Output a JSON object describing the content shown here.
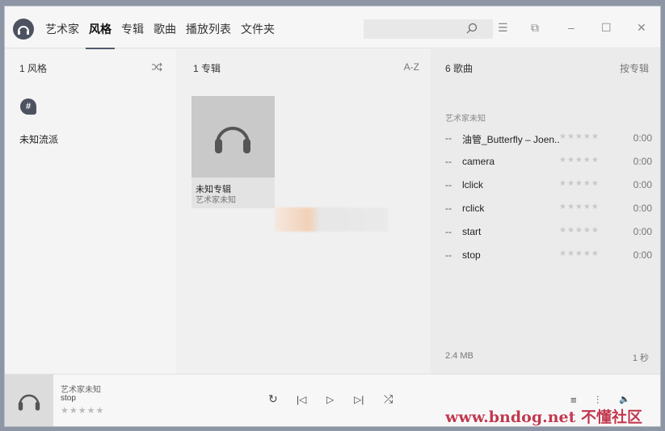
{
  "tabs": [
    {
      "label": "艺术家"
    },
    {
      "label": "风格",
      "active": true
    },
    {
      "label": "专辑"
    },
    {
      "label": "歌曲"
    },
    {
      "label": "播放列表"
    },
    {
      "label": "文件夹"
    }
  ],
  "search": {
    "value": "",
    "icon": "search-icon"
  },
  "window_controls": {
    "menu_icon": "☰",
    "snap_icon": "⧉",
    "minimize": "–",
    "maximize": "☐",
    "close": "✕"
  },
  "genres_panel": {
    "header": "1 风格",
    "action_icon": "shuffle-icon",
    "badge": "#",
    "items": [
      "未知流派"
    ]
  },
  "albums_panel": {
    "header": "1 专辑",
    "sort": "A-Z",
    "albums": [
      {
        "title": "未知专辑",
        "artist": "艺术家未知"
      }
    ]
  },
  "songs_panel": {
    "header": "6 歌曲",
    "sort": "按专辑",
    "artist_group": "艺术家未知",
    "songs": [
      {
        "dash": "--",
        "title": "油管_Butterfly – Joen...",
        "stars": "★★★★★",
        "duration": "0:00"
      },
      {
        "dash": "--",
        "title": "camera",
        "stars": "★★★★★",
        "duration": "0:00"
      },
      {
        "dash": "--",
        "title": "lclick",
        "stars": "★★★★★",
        "duration": "0:00"
      },
      {
        "dash": "--",
        "title": "rclick",
        "stars": "★★★★★",
        "duration": "0:00"
      },
      {
        "dash": "--",
        "title": "start",
        "stars": "★★★★★",
        "duration": "0:00"
      },
      {
        "dash": "--",
        "title": "stop",
        "stars": "★★★★★",
        "duration": "0:00"
      }
    ],
    "total_size": "2.4 MB",
    "total_duration": "1 秒"
  },
  "now_playing": {
    "artist": "艺术家未知",
    "title": "stop",
    "stars": "★★★★★"
  },
  "player_controls": {
    "repeat": "↻",
    "prev": "|◁",
    "play": "▷",
    "next": "▷|",
    "shuffle": "⤮",
    "queue": "≡",
    "equalizer": "⫶",
    "volume": "🔈"
  },
  "watermark": "www.bndog.net 不懂社区",
  "colors": {
    "accent": "#4f5a6e",
    "logo": "#4d5260",
    "watermark": "#c0394f"
  }
}
